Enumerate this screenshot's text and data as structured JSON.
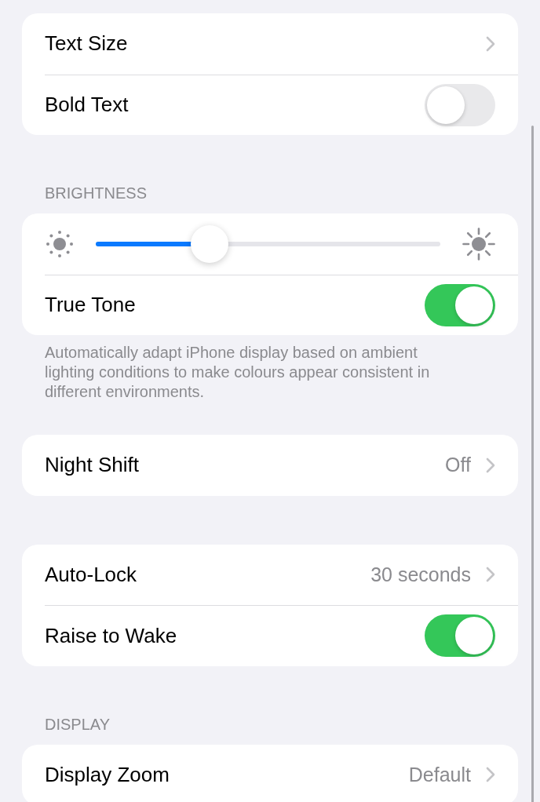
{
  "sections": [
    {
      "rows": [
        {
          "kind": "link",
          "label": "Text Size"
        },
        {
          "kind": "toggle",
          "label": "Bold Text",
          "on": false
        }
      ]
    },
    {
      "header": "BRIGHTNESS",
      "rows": [
        {
          "kind": "slider",
          "level": 0.33
        },
        {
          "kind": "toggle",
          "label": "True Tone",
          "on": true
        }
      ],
      "footer": "Automatically adapt iPhone display based on ambient lighting conditions to make colours appear consistent in different environments."
    },
    {
      "rows": [
        {
          "kind": "link",
          "label": "Night Shift",
          "value": "Off"
        }
      ]
    },
    {
      "rows": [
        {
          "kind": "link",
          "label": "Auto-Lock",
          "value": "30 seconds"
        },
        {
          "kind": "toggle",
          "label": "Raise to Wake",
          "on": true
        }
      ]
    },
    {
      "header": "DISPLAY",
      "rows": [
        {
          "kind": "link",
          "label": "Display Zoom",
          "value": "Default"
        }
      ]
    }
  ]
}
